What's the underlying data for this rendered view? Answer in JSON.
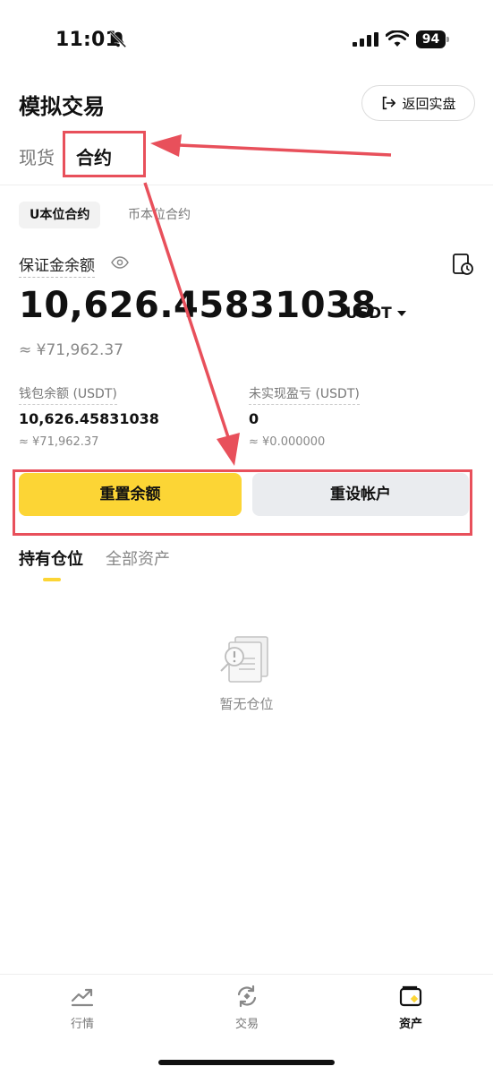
{
  "status": {
    "time": "11:01",
    "battery": "94"
  },
  "header": {
    "title": "模拟交易",
    "back_button": "返回实盘"
  },
  "main_tabs": [
    {
      "label": "现货"
    },
    {
      "label": "合约"
    }
  ],
  "sub_tabs": [
    {
      "label": "U本位合约"
    },
    {
      "label": "币本位合约"
    }
  ],
  "account": {
    "margin_label": "保证金余额",
    "balance": "10,626.45831038",
    "currency": "USDT",
    "balance_cny": "≈ ¥71,962.37"
  },
  "stats": [
    {
      "label": "钱包余额 (USDT)",
      "value": "10,626.45831038",
      "approx": "≈ ¥71,962.37"
    },
    {
      "label": "未实现盈亏 (USDT)",
      "value": "0",
      "approx": "≈ ¥0.000000"
    }
  ],
  "actions": {
    "reset_balance": "重置余额",
    "reset_account": "重设帐户"
  },
  "position_tabs": [
    {
      "label": "持有仓位"
    },
    {
      "label": "全部资产"
    }
  ],
  "empty_state": "暂无仓位",
  "bottom_nav": [
    {
      "label": "行情"
    },
    {
      "label": "交易"
    },
    {
      "label": "资产"
    }
  ],
  "colors": {
    "accent": "#fcd535",
    "annotation": "#e8505b"
  }
}
